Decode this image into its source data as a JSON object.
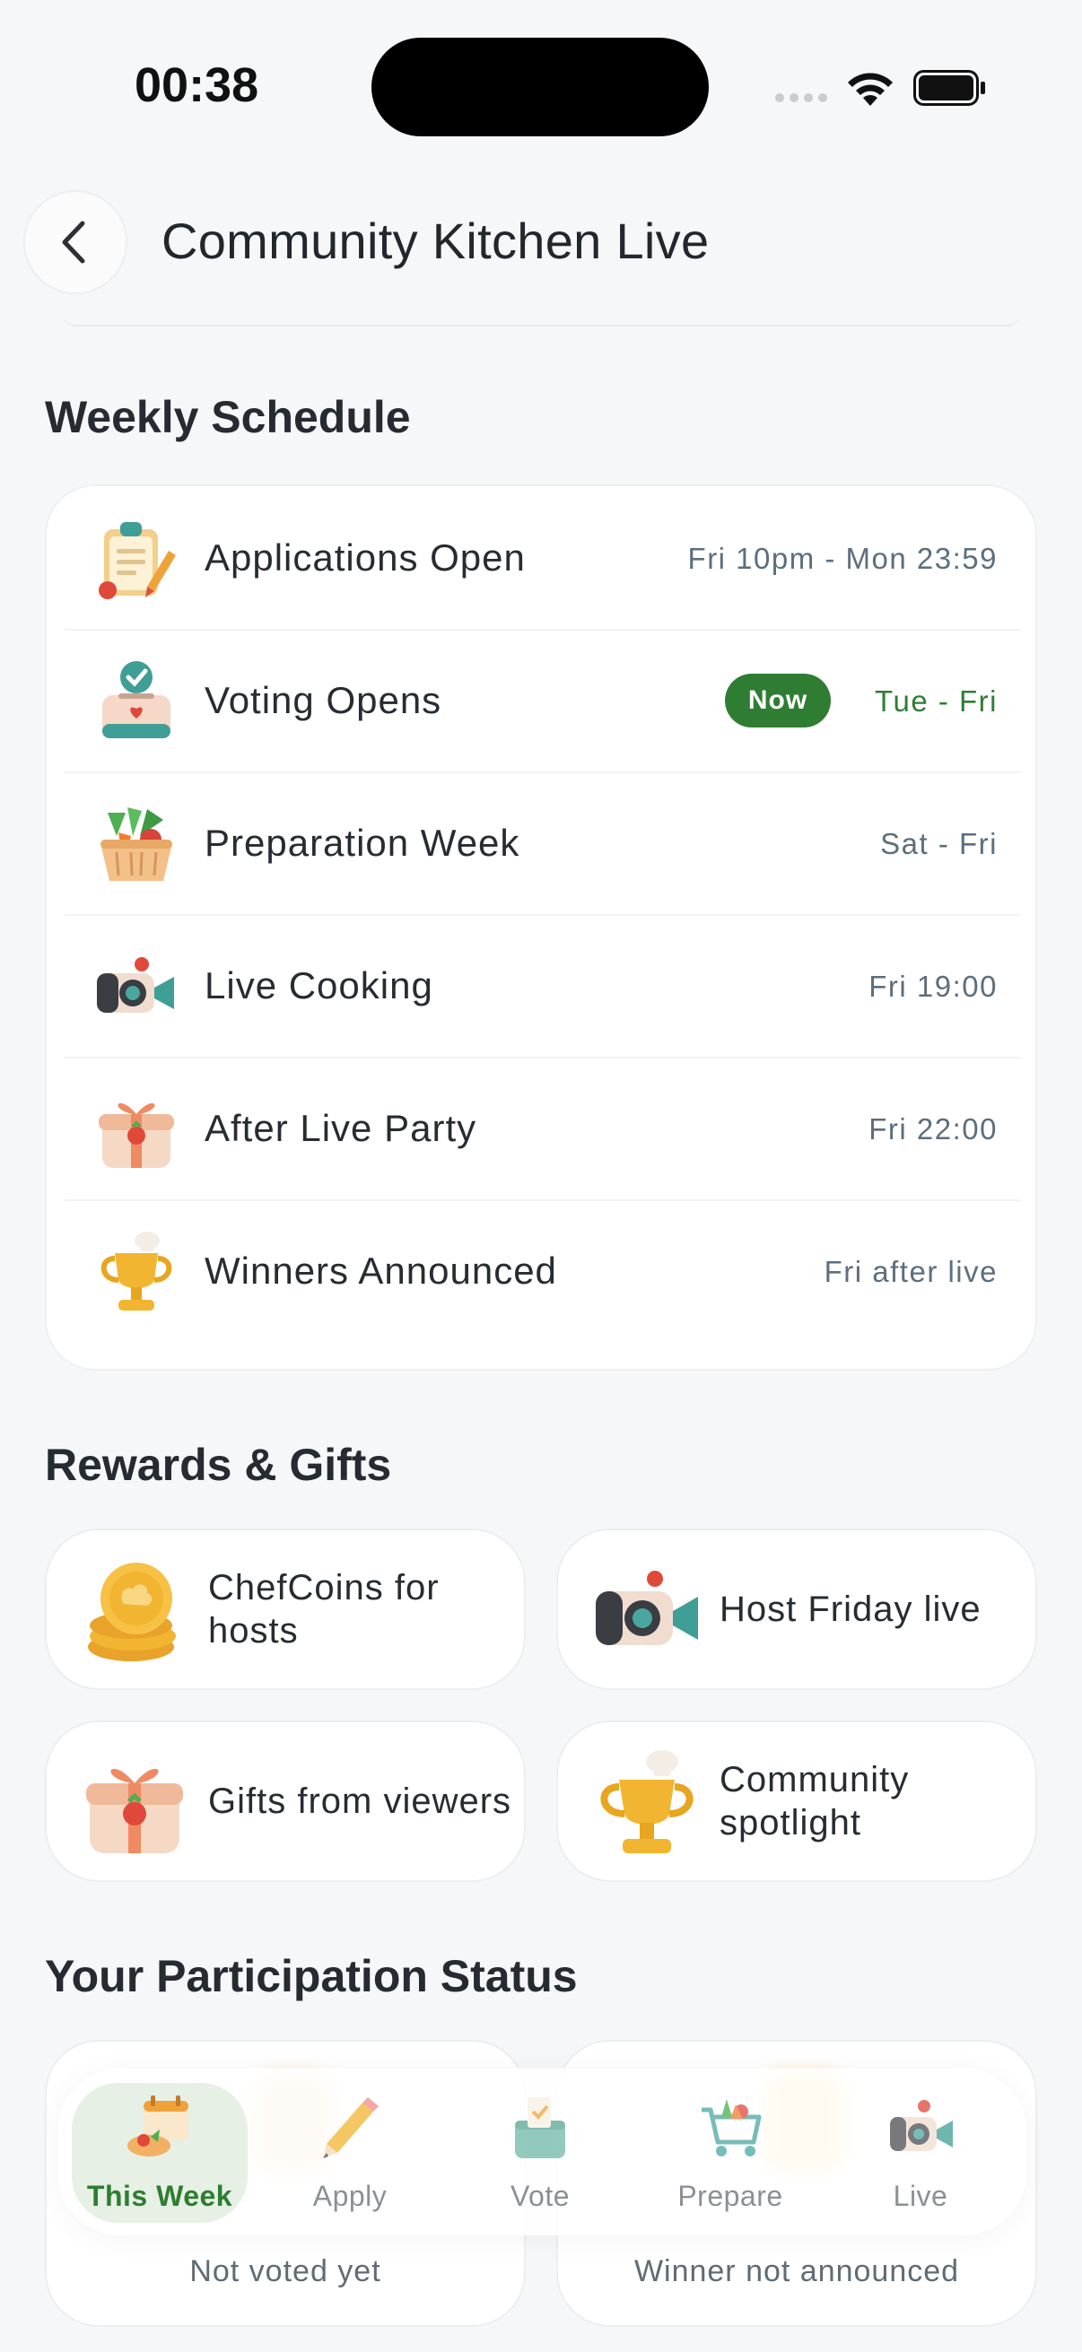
{
  "status_bar": {
    "time": "00:38"
  },
  "header": {
    "title": "Community Kitchen Live"
  },
  "schedule": {
    "heading": "Weekly Schedule",
    "rows": [
      {
        "label": "Applications Open",
        "time": "Fri 10pm - Mon 23:59",
        "icon": "clipboard-icon"
      },
      {
        "label": "Voting Opens",
        "time": "Tue - Fri",
        "badge": "Now",
        "icon": "ballot-box-icon"
      },
      {
        "label": "Preparation Week",
        "time": "Sat - Fri",
        "icon": "vegetable-basket-icon"
      },
      {
        "label": "Live Cooking",
        "time": "Fri 19:00",
        "icon": "video-camera-icon"
      },
      {
        "label": "After Live Party",
        "time": "Fri 22:00",
        "icon": "gift-icon"
      },
      {
        "label": "Winners Announced",
        "time": "Fri after live",
        "icon": "trophy-icon"
      }
    ]
  },
  "rewards": {
    "heading": "Rewards & Gifts",
    "items": [
      {
        "label": "ChefCoins for hosts",
        "icon": "coins-icon"
      },
      {
        "label": "Host Friday live",
        "icon": "video-camera-icon"
      },
      {
        "label": "Gifts from viewers",
        "icon": "gift-icon"
      },
      {
        "label": "Community spotlight",
        "icon": "trophy-icon"
      }
    ]
  },
  "participation": {
    "heading": "Your Participation Status",
    "cards": [
      {
        "status": "Not voted yet"
      },
      {
        "status": "Winner not announced"
      }
    ]
  },
  "tabs": [
    {
      "label": "This Week",
      "icon": "calendar-icon",
      "active": true
    },
    {
      "label": "Apply",
      "icon": "pencil-icon"
    },
    {
      "label": "Vote",
      "icon": "ballot-box-icon"
    },
    {
      "label": "Prepare",
      "icon": "shopping-cart-icon"
    },
    {
      "label": "Live",
      "icon": "video-camera-icon"
    }
  ],
  "colors": {
    "accent": "#2e7d32",
    "background": "#f6f7f9",
    "card": "#ffffff"
  }
}
